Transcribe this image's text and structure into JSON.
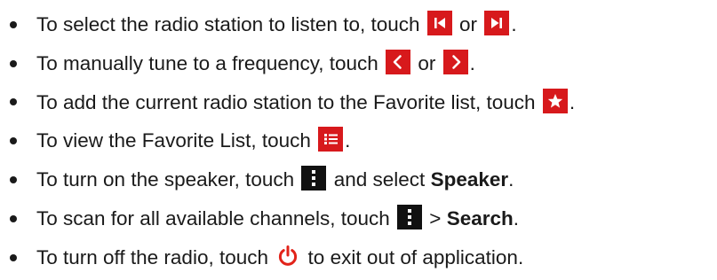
{
  "colors": {
    "text": "#1a1a1a",
    "icon_bg": "#d7191c",
    "menu_bg": "#111111",
    "power": "#e2231a"
  },
  "items": [
    {
      "text_a": "To select the radio station to listen to, touch",
      "icon_a": "skip-previous-icon",
      "joiner": "or",
      "icon_b": "skip-next-icon",
      "text_end": "."
    },
    {
      "text_a": "To manually tune to a frequency, touch",
      "icon_a": "chevron-left-icon",
      "joiner": "or",
      "icon_b": "chevron-right-icon",
      "text_end": "."
    },
    {
      "text_a": "To add the current radio station to the Favorite list, touch",
      "icon_a": "star-icon",
      "text_end": "."
    },
    {
      "text_a": "To view the Favorite List, touch",
      "icon_a": "list-icon",
      "text_end": "."
    },
    {
      "text_a": "To turn on the speaker, touch",
      "icon_a": "more-vertical-icon",
      "text_mid": "and select",
      "bold": "Speaker",
      "text_end": "."
    },
    {
      "text_a": "To scan for all available channels, touch",
      "icon_a": "more-vertical-icon",
      "text_mid": ">",
      "bold": "Search",
      "text_end": "."
    },
    {
      "text_a": "To turn off the radio, touch",
      "icon_a": "power-icon",
      "text_mid": "to exit out of application."
    }
  ]
}
